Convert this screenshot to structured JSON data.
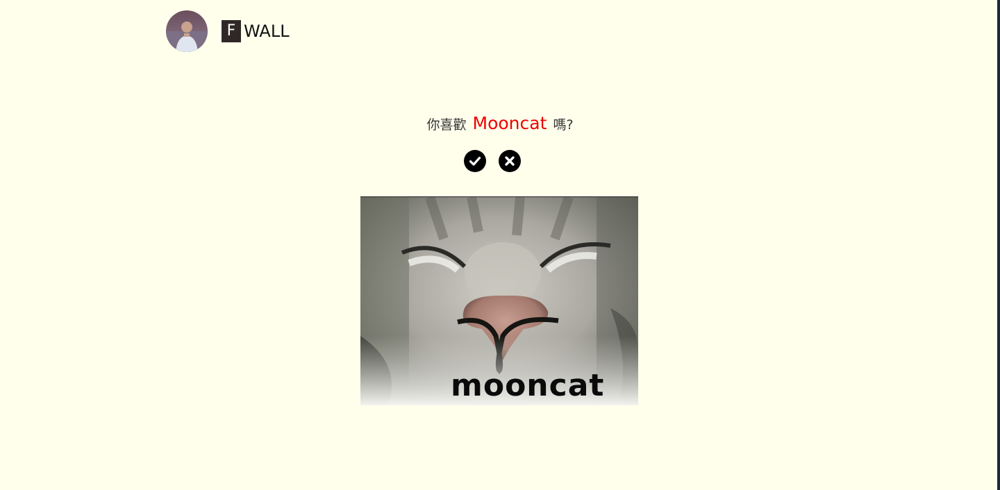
{
  "brand": {
    "letter": "F",
    "rest": "WALL"
  },
  "question": {
    "prefix": "你喜歡",
    "highlight": "Mooncat",
    "suffix": "嗎?"
  },
  "actions": {
    "like_icon": "check-circle-icon",
    "dislike_icon": "times-circle-icon"
  },
  "photo": {
    "caption": "mooncat"
  },
  "colors": {
    "background": "#ffffec",
    "highlight": "#ee0000",
    "brand_box": "#2f2827"
  }
}
